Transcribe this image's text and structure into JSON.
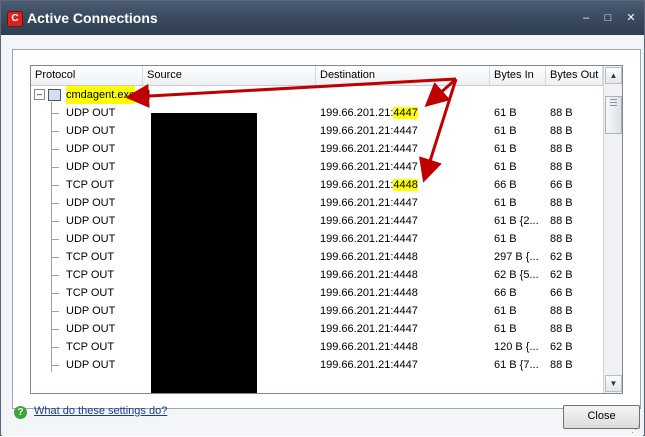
{
  "window": {
    "title": "Active Connections",
    "app_icon": "C",
    "controls": {
      "minimize": "–",
      "maximize": "□",
      "close": "✕"
    }
  },
  "columns": [
    "Protocol",
    "Source",
    "Destination",
    "Bytes In",
    "Bytes Out"
  ],
  "process": {
    "name": "cmdagent.exe",
    "pid": "[..]",
    "expander": "–"
  },
  "connections": [
    {
      "protocol": "UDP OUT",
      "dest_ip": "199.66.201.21:",
      "dest_port": "4447",
      "bytes_in": "61 B",
      "bytes_out": "88 B",
      "highlight": true
    },
    {
      "protocol": "UDP OUT",
      "dest_ip": "199.66.201.21:",
      "dest_port": "4447",
      "bytes_in": "61 B",
      "bytes_out": "88 B",
      "highlight": false
    },
    {
      "protocol": "UDP OUT",
      "dest_ip": "199.66.201.21:",
      "dest_port": "4447",
      "bytes_in": "61 B",
      "bytes_out": "88 B",
      "highlight": false
    },
    {
      "protocol": "UDP OUT",
      "dest_ip": "199.66.201.21:",
      "dest_port": "4447",
      "bytes_in": "61 B",
      "bytes_out": "88 B",
      "highlight": false
    },
    {
      "protocol": "TCP OUT",
      "dest_ip": "199.66.201.21:",
      "dest_port": "4448",
      "bytes_in": "66 B",
      "bytes_out": "66 B",
      "highlight": true
    },
    {
      "protocol": "UDP OUT",
      "dest_ip": "199.66.201.21:",
      "dest_port": "4447",
      "bytes_in": "61 B",
      "bytes_out": "88 B",
      "highlight": false
    },
    {
      "protocol": "UDP OUT",
      "dest_ip": "199.66.201.21:",
      "dest_port": "4447",
      "bytes_in": "61 B {2...",
      "bytes_out": "88 B",
      "highlight": false
    },
    {
      "protocol": "UDP OUT",
      "dest_ip": "199.66.201.21:",
      "dest_port": "4447",
      "bytes_in": "61 B",
      "bytes_out": "88 B",
      "highlight": false
    },
    {
      "protocol": "TCP OUT",
      "dest_ip": "199.66.201.21:",
      "dest_port": "4448",
      "bytes_in": "297 B {...",
      "bytes_out": "62 B",
      "highlight": false
    },
    {
      "protocol": "TCP OUT",
      "dest_ip": "199.66.201.21:",
      "dest_port": "4448",
      "bytes_in": "62 B {5...",
      "bytes_out": "62 B",
      "highlight": false
    },
    {
      "protocol": "TCP OUT",
      "dest_ip": "199.66.201.21:",
      "dest_port": "4448",
      "bytes_in": "66 B",
      "bytes_out": "66 B",
      "highlight": false
    },
    {
      "protocol": "UDP OUT",
      "dest_ip": "199.66.201.21:",
      "dest_port": "4447",
      "bytes_in": "61 B",
      "bytes_out": "88 B",
      "highlight": false
    },
    {
      "protocol": "UDP OUT",
      "dest_ip": "199.66.201.21:",
      "dest_port": "4447",
      "bytes_in": "61 B",
      "bytes_out": "88 B",
      "highlight": false
    },
    {
      "protocol": "TCP OUT",
      "dest_ip": "199.66.201.21:",
      "dest_port": "4448",
      "bytes_in": "120 B {...",
      "bytes_out": "62 B",
      "highlight": false
    },
    {
      "protocol": "UDP OUT",
      "dest_ip": "199.66.201.21:",
      "dest_port": "4447",
      "bytes_in": "61 B {7...",
      "bytes_out": "88 B",
      "highlight": false
    }
  ],
  "footer": {
    "help_text": "What do these settings do?",
    "help_icon": "?",
    "close_label": "Close"
  },
  "colors": {
    "highlight": "#ffff00",
    "arrow": "#c00000",
    "titlebar": "#3a4a5f"
  }
}
